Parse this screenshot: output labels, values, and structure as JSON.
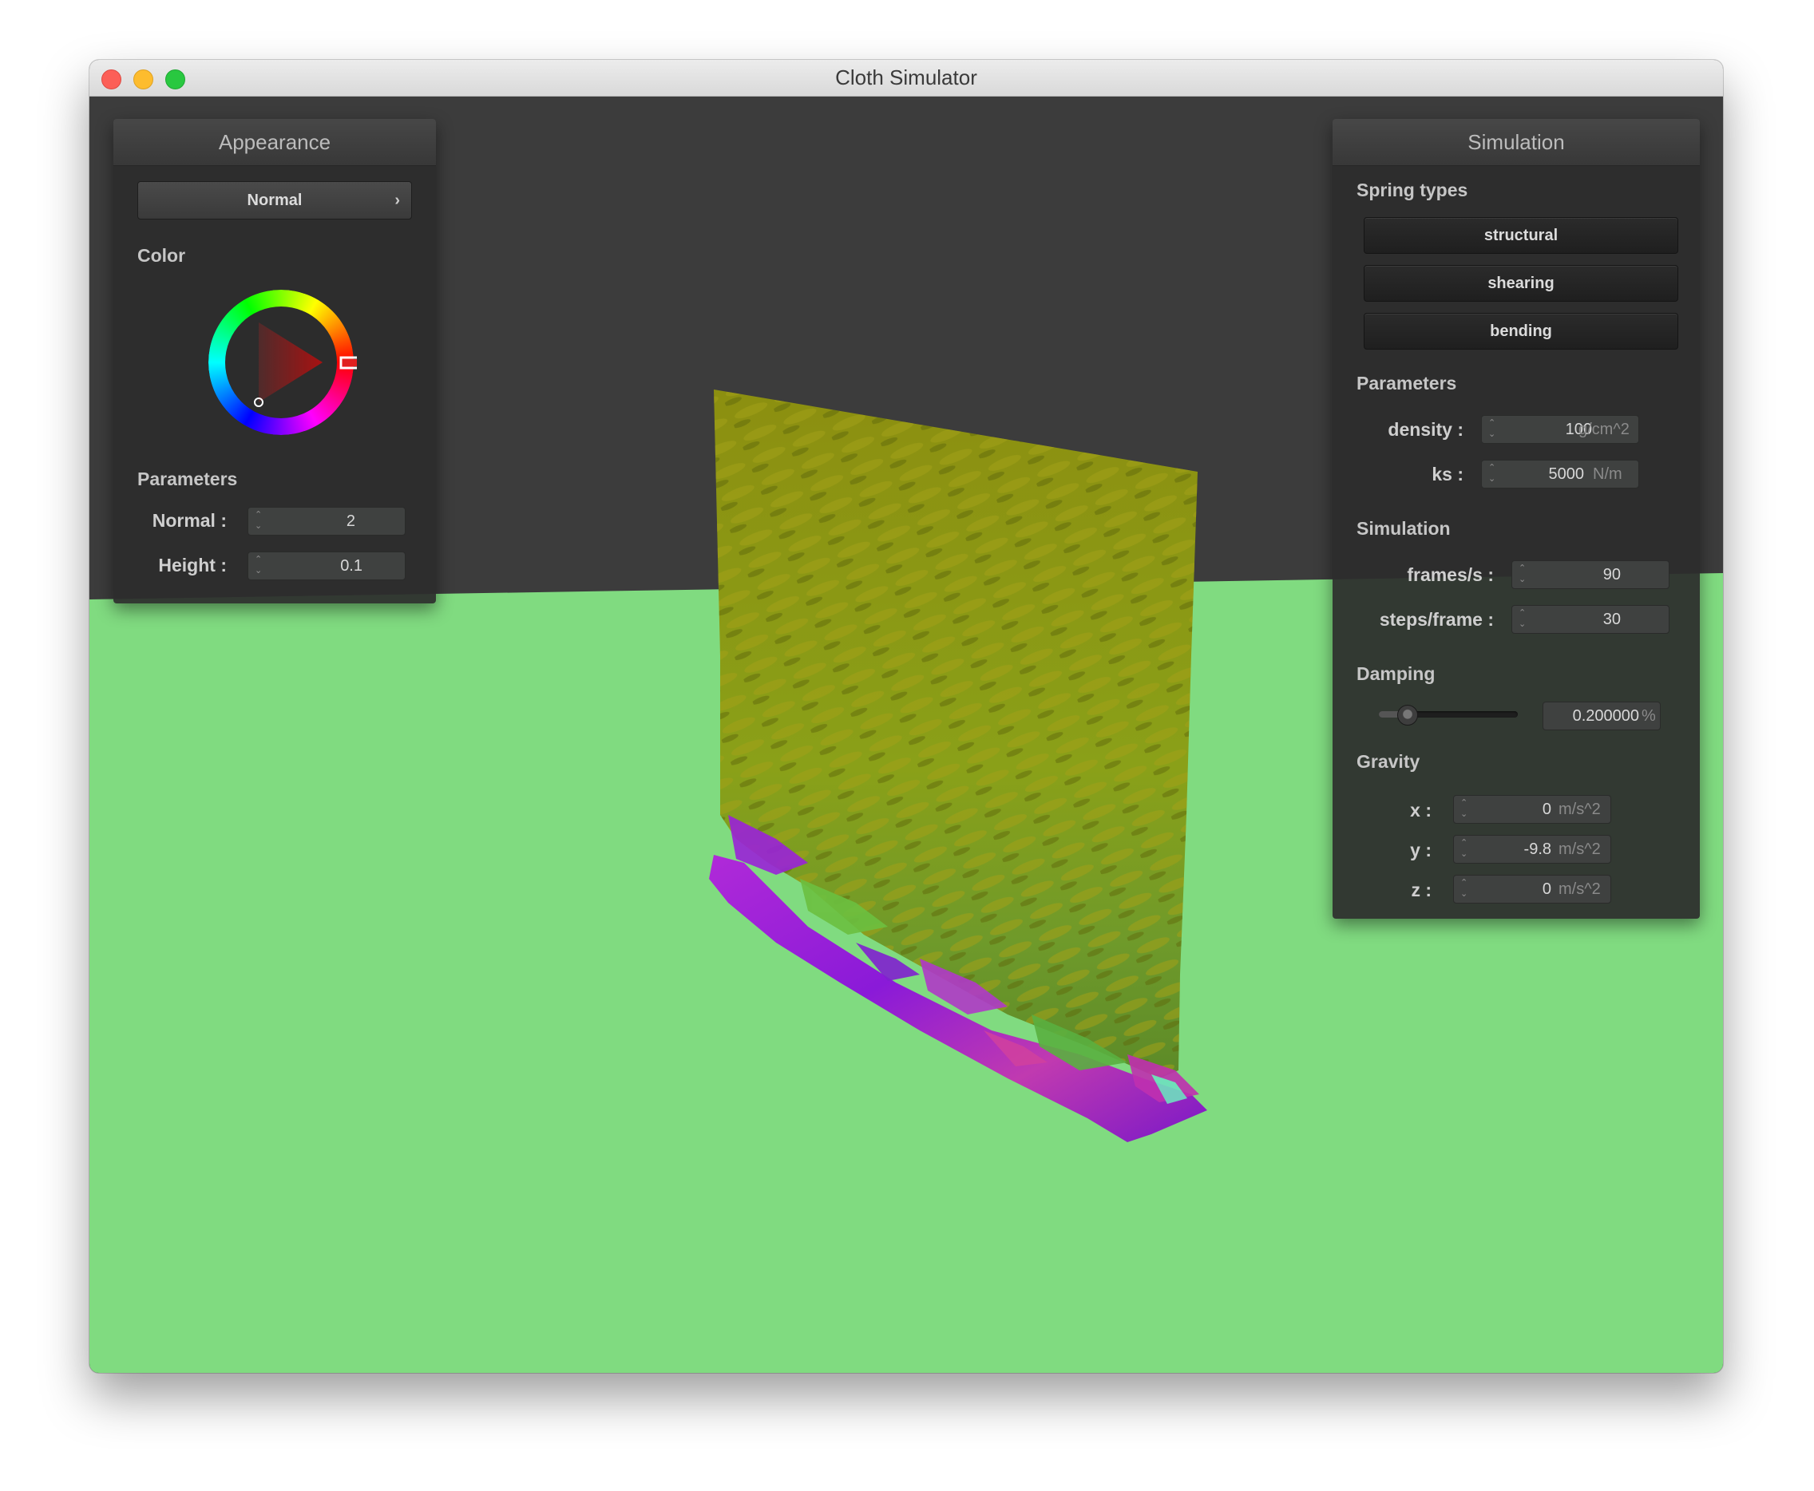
{
  "window": {
    "title": "Cloth Simulator"
  },
  "appearance": {
    "header": "Appearance",
    "shader_label": "Normal",
    "chevron": "›",
    "color_label": "Color",
    "parameters_label": "Parameters",
    "normal": {
      "label": "Normal :",
      "value": "2"
    },
    "height": {
      "label": "Height :",
      "value": "0.1"
    }
  },
  "simulation": {
    "header": "Simulation",
    "spring_types_label": "Spring types",
    "springs": [
      "structural",
      "shearing",
      "bending"
    ],
    "parameters_label": "Parameters",
    "density": {
      "label": "density :",
      "value": "100",
      "unit": "g/cm^2"
    },
    "ks": {
      "label": "ks :",
      "value": "5000",
      "unit": "N/m"
    },
    "simulation_label": "Simulation",
    "fps": {
      "label": "frames/s :",
      "value": "90"
    },
    "steps": {
      "label": "steps/frame :",
      "value": "30"
    },
    "damping_label": "Damping",
    "damping": {
      "value": "0.200000",
      "unit": "%",
      "fraction": 0.2
    },
    "gravity_label": "Gravity",
    "gx": {
      "label": "x :",
      "value": "0",
      "unit": "m/s^2"
    },
    "gy": {
      "label": "y :",
      "value": "-9.8",
      "unit": "m/s^2"
    },
    "gz": {
      "label": "z :",
      "value": "0",
      "unit": "m/s^2"
    }
  },
  "colors": {
    "ground": "#80db80",
    "background": "#3c3c3c",
    "cloth": "#8a9a12",
    "cloth_fold": "#a020e0",
    "picker_selected": "#e02020"
  }
}
